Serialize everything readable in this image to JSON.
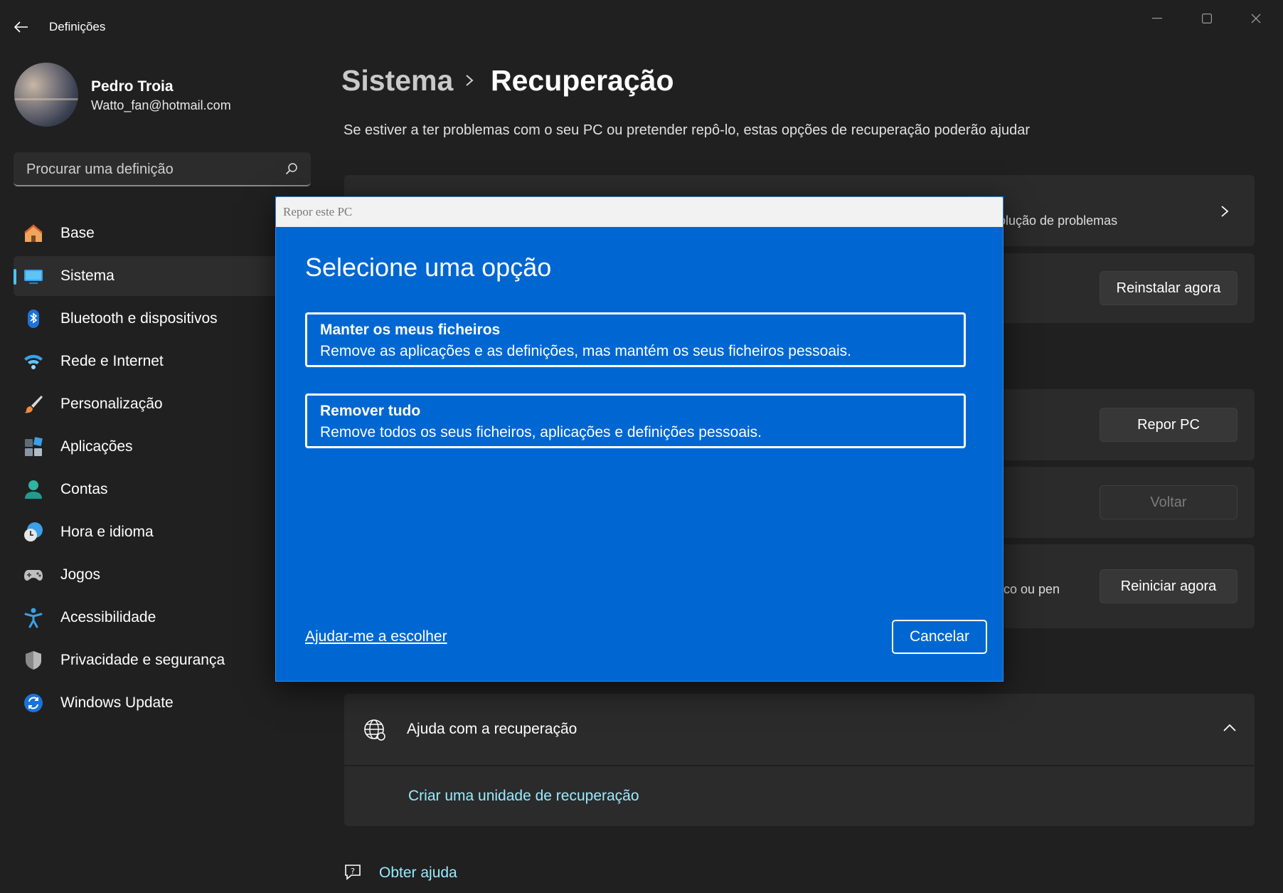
{
  "app": {
    "title": "Definições"
  },
  "profile": {
    "name": "Pedro Troia",
    "email": "Watto_fan@hotmail.com"
  },
  "search": {
    "placeholder": "Procurar uma definição"
  },
  "nav": {
    "items": [
      {
        "label": "Base",
        "icon": "home-icon"
      },
      {
        "label": "Sistema",
        "icon": "system-icon",
        "active": true
      },
      {
        "label": "Bluetooth e dispositivos",
        "icon": "bluetooth-icon"
      },
      {
        "label": "Rede e Internet",
        "icon": "wifi-icon"
      },
      {
        "label": "Personalização",
        "icon": "brush-icon"
      },
      {
        "label": "Aplicações",
        "icon": "apps-icon"
      },
      {
        "label": "Contas",
        "icon": "accounts-icon"
      },
      {
        "label": "Hora e idioma",
        "icon": "time-language-icon"
      },
      {
        "label": "Jogos",
        "icon": "gamepad-icon"
      },
      {
        "label": "Acessibilidade",
        "icon": "accessibility-icon"
      },
      {
        "label": "Privacidade e segurança",
        "icon": "shield-icon"
      },
      {
        "label": "Windows Update",
        "icon": "update-icon"
      }
    ]
  },
  "breadcrumb": {
    "parent": "Sistema",
    "current": "Recuperação"
  },
  "page": {
    "subtitle": "Se estiver a ter problemas com o seu PC ou pretender repô-lo, estas opções de recuperação poderão ajudar"
  },
  "cards": {
    "troubleshoot_text": "olução de problemas",
    "reinstall_button": "Reinstalar agora",
    "reset_button": "Repor PC",
    "goback_button": "Voltar",
    "advanced_text": "sco ou pen",
    "restart_button": "Reiniciar agora"
  },
  "help": {
    "title": "Ajuda com a recuperação",
    "link": "Criar uma unidade de recuperação"
  },
  "get_help": {
    "label": "Obter ajuda"
  },
  "dialog": {
    "title": "Repor este PC",
    "heading": "Selecione uma opção",
    "options": [
      {
        "title": "Manter os meus ficheiros",
        "description": "Remove as aplicações e as definições, mas mantém os seus ficheiros pessoais."
      },
      {
        "title": "Remover tudo",
        "description": "Remove todos os seus ficheiros, aplicações e definições pessoais."
      }
    ],
    "help_link": "Ajudar-me a escolher",
    "cancel": "Cancelar"
  },
  "colors": {
    "background": "#202020",
    "dialog_blue": "#0067d2",
    "accent": "#4cc2ff",
    "link": "#99ebff"
  }
}
